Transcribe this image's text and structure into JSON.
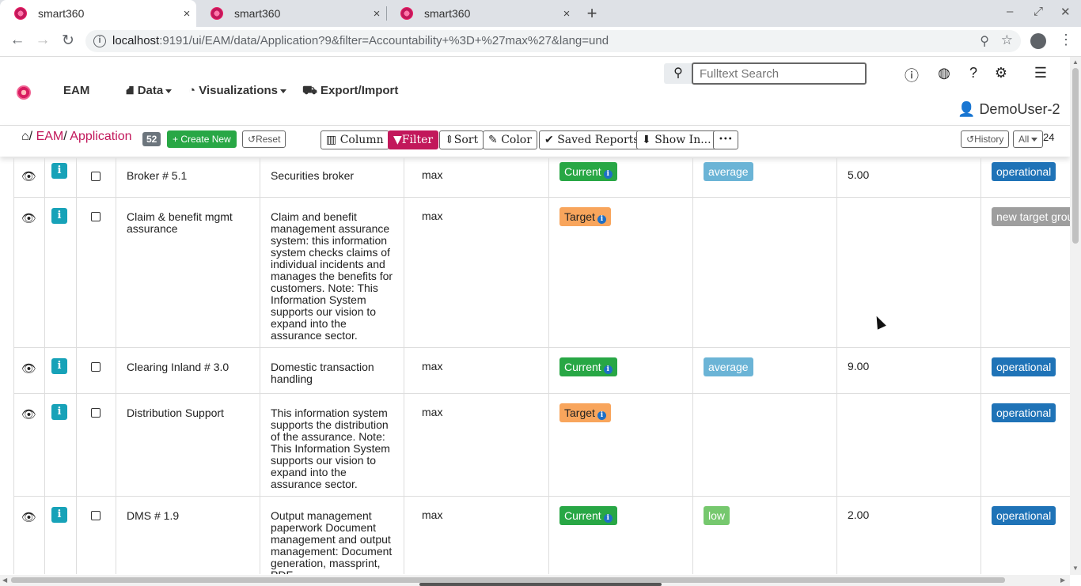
{
  "browser": {
    "tabs": [
      {
        "title": "smart360",
        "close": "×"
      },
      {
        "title": "smart360",
        "close": "×"
      },
      {
        "title": "smart360",
        "close": "×"
      }
    ],
    "new_tab": "+",
    "window_controls": {
      "minimize": "–",
      "restore": "⤢",
      "close": "✕"
    },
    "url_host": "localhost",
    "url_rest": ":9191/ui/EAM/data/Application?9&filter=Accountability+%3D+%27max%27&lang=und"
  },
  "app": {
    "brand": "EAM",
    "menus": [
      {
        "label": "Data",
        "icon": "sitemap-icon"
      },
      {
        "label": "Visualizations",
        "icon": "dashboard-icon"
      },
      {
        "label": "Export/Import",
        "icon": "truck-icon"
      }
    ],
    "search_placeholder": "Fulltext Search",
    "user": "DemoUser-2"
  },
  "breadcrumb": {
    "sep": "/",
    "module": "EAM",
    "entity": "Application",
    "count": "52"
  },
  "actions": {
    "create_new": "Create New",
    "reset": "Reset",
    "column": "Column",
    "filter": "Filter",
    "sort": "Sort",
    "color": "Color",
    "saved_reports": "Saved Reports",
    "show_in": "Show In...",
    "more": "•••",
    "history": "History",
    "page_size": "All",
    "total": "24"
  },
  "rows": [
    {
      "name": "Broker # 5.1",
      "description": "Securities broker",
      "accountability": "max",
      "status": "Current",
      "status_kind": "current",
      "rating": "average",
      "rating_kind": "average",
      "value": "5.00",
      "lifecycle": "operational",
      "lifecycle_kind": "operational"
    },
    {
      "name": "Claim & benefit mgmt assurance",
      "description": "Claim and benefit management assurance system: this information system checks claims of individual incidents and manages the benefits for customers. Note: This Information System supports our vision to expand into the assurance sector.",
      "accountability": "max",
      "status": "Target",
      "status_kind": "target",
      "rating": "",
      "rating_kind": "",
      "value": "",
      "lifecycle": "new target group",
      "lifecycle_kind": "newtarget"
    },
    {
      "name": "Clearing Inland # 3.0",
      "description": "Domestic transaction handling",
      "accountability": "max",
      "status": "Current",
      "status_kind": "current",
      "rating": "average",
      "rating_kind": "average",
      "value": "9.00",
      "lifecycle": "operational",
      "lifecycle_kind": "operational"
    },
    {
      "name": "Distribution Support",
      "description": "This information system supports the distribution of the assurance. Note: This Information System supports our vision to expand into the assurance sector.",
      "accountability": "max",
      "status": "Target",
      "status_kind": "target",
      "rating": "",
      "rating_kind": "",
      "value": "",
      "lifecycle": "operational",
      "lifecycle_kind": "operational"
    },
    {
      "name": "DMS # 1.9",
      "description": "Output management paperwork Document management and output management: Document generation, massprint, PDF",
      "accountability": "max",
      "status": "Current",
      "status_kind": "current",
      "rating": "low",
      "rating_kind": "low",
      "value": "2.00",
      "lifecycle": "operational",
      "lifecycle_kind": "operational"
    }
  ]
}
